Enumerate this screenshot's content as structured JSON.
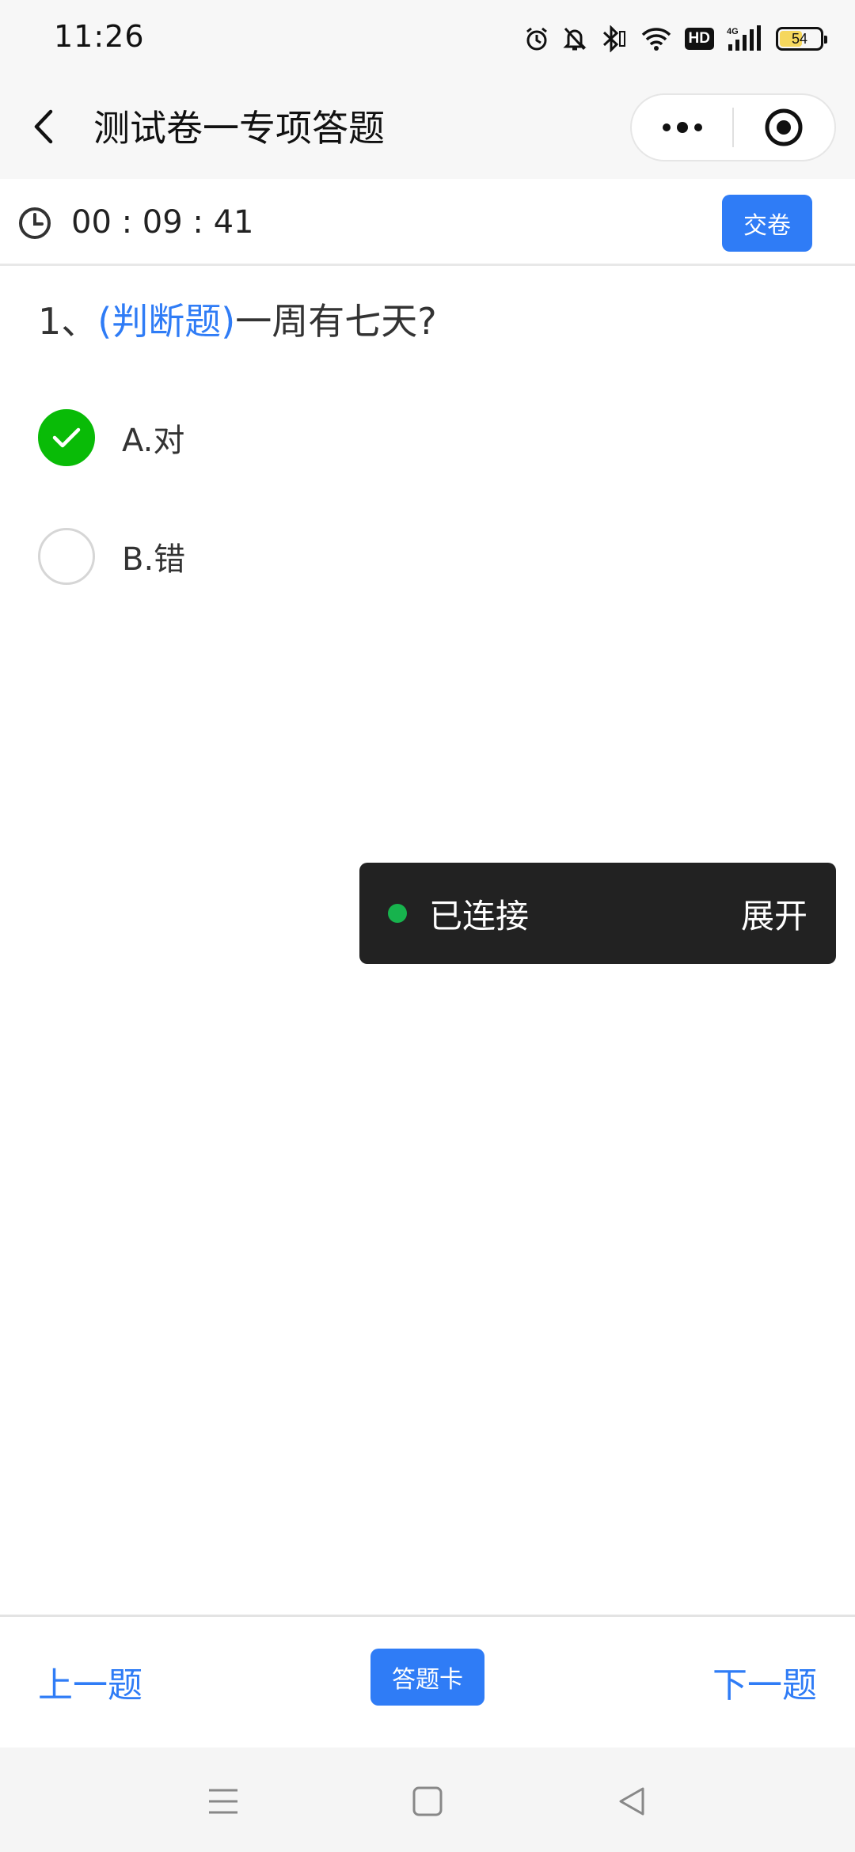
{
  "status_bar": {
    "time": "11:26",
    "icons": [
      "alarm-icon",
      "mute-bell-icon",
      "bluetooth-icon",
      "wifi-icon",
      "hd-icon",
      "signal-4g-icon",
      "battery-icon"
    ],
    "hd_label": "HD",
    "network_label": "4G",
    "battery_level": "54"
  },
  "nav": {
    "title": "测试卷一专项答题",
    "back_icon": "chevron-left-icon",
    "more_icon": "more-dots-icon",
    "target_icon": "target-icon"
  },
  "timer": {
    "icon": "clock-icon",
    "value": "00 : 09 : 41",
    "submit_label": "交卷"
  },
  "question": {
    "number": "1、",
    "type": "(判断题)",
    "text": "一周有七天?",
    "options": [
      {
        "label": "A.对",
        "selected": true
      },
      {
        "label": "B.错",
        "selected": false
      }
    ]
  },
  "toast": {
    "status": "已连接",
    "action": "展开",
    "dot_color": "#17b34d"
  },
  "bottom": {
    "prev_label": "上一题",
    "card_label": "答题卡",
    "next_label": "下一题"
  },
  "system_nav": {
    "icons": [
      "menu-icon",
      "home-square-icon",
      "back-triangle-icon"
    ]
  },
  "colors": {
    "accent": "#2f7cf6",
    "selected": "#09bb07"
  }
}
